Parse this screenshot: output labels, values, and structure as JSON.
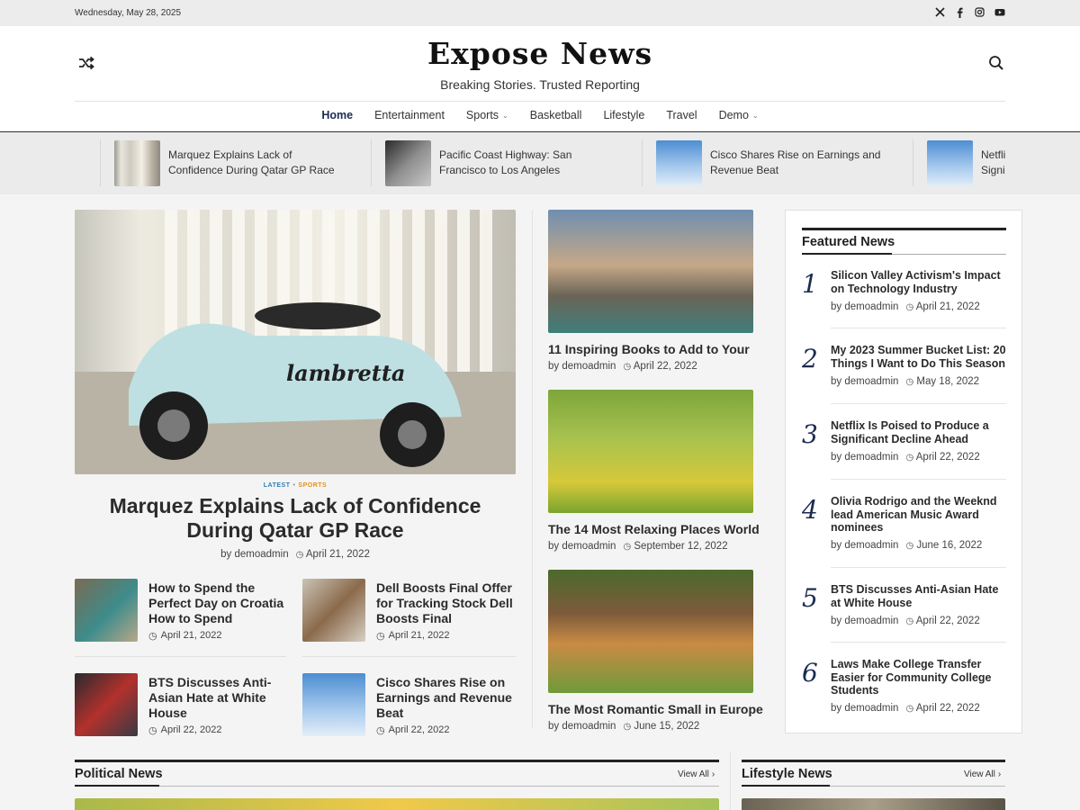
{
  "topbar": {
    "date": "Wednesday, May 28, 2025",
    "social": [
      "x-icon",
      "facebook-icon",
      "instagram-icon",
      "youtube-icon"
    ]
  },
  "header": {
    "title": "Expose News",
    "tagline": "Breaking Stories. Trusted Reporting"
  },
  "nav": [
    {
      "label": "Home",
      "active": true
    },
    {
      "label": "Entertainment"
    },
    {
      "label": "Sports",
      "dropdown": true
    },
    {
      "label": "Basketball"
    },
    {
      "label": "Lifestyle"
    },
    {
      "label": "Travel"
    },
    {
      "label": "Demo",
      "dropdown": true
    }
  ],
  "ticker": [
    {
      "title": "Marquez Explains Lack of Confidence During Qatar GP Race"
    },
    {
      "title": "Pacific Coast Highway: San Francisco to Los Angeles"
    },
    {
      "title": "Cisco Shares Rise on Earnings and Revenue Beat"
    },
    {
      "title": "Netfli Signi"
    }
  ],
  "hero": {
    "categories": [
      "LATEST",
      "SPORTS"
    ],
    "title": "Marquez Explains Lack of Confidence During Qatar GP Race",
    "author": "demoadmin",
    "date": "April 21, 2022"
  },
  "small_posts": [
    {
      "title": "How to Spend the Perfect Day on Croatia How to Spend",
      "date": "April 21, 2022"
    },
    {
      "title": "Dell Boosts Final Offer for Tracking Stock Dell Boosts Final",
      "date": "April 21, 2022"
    },
    {
      "title": "BTS Discusses Anti-Asian Hate at White House",
      "date": "April 22, 2022"
    },
    {
      "title": "Cisco Shares Rise on Earnings and Revenue Beat",
      "date": "April 22, 2022"
    }
  ],
  "cards": [
    {
      "title": "11 Inspiring Books to Add to Your",
      "author": "demoadmin",
      "date": "April 22, 2022"
    },
    {
      "title": "The 14 Most Relaxing Places World",
      "author": "demoadmin",
      "date": "September 12, 2022"
    },
    {
      "title": "The Most Romantic Small in Europe",
      "author": "demoadmin",
      "date": "June 15, 2022"
    }
  ],
  "featured": {
    "heading": "Featured News",
    "items": [
      {
        "num": "1",
        "title": "Silicon Valley Activism's Impact on Technology Industry",
        "author": "demoadmin",
        "date": "April 21, 2022"
      },
      {
        "num": "2",
        "title": "My 2023 Summer Bucket List: 20 Things I Want to Do This Season",
        "author": "demoadmin",
        "date": "May 18, 2022"
      },
      {
        "num": "3",
        "title": "Netflix Is Poised to Produce a Significant Decline Ahead",
        "author": "demoadmin",
        "date": "April 22, 2022"
      },
      {
        "num": "4",
        "title": "Olivia Rodrigo and the Weeknd lead American Music Award nominees",
        "author": "demoadmin",
        "date": "June 16, 2022"
      },
      {
        "num": "5",
        "title": "BTS Discusses Anti-Asian Hate at White House",
        "author": "demoadmin",
        "date": "April 22, 2022"
      },
      {
        "num": "6",
        "title": "Laws Make College Transfer Easier for Community College Students",
        "author": "demoadmin",
        "date": "April 22, 2022"
      }
    ]
  },
  "sections": {
    "political": {
      "title": "Political News",
      "view_all": "View All"
    },
    "lifestyle": {
      "title": "Lifestyle News",
      "view_all": "View All"
    }
  },
  "labels": {
    "by": "by"
  }
}
